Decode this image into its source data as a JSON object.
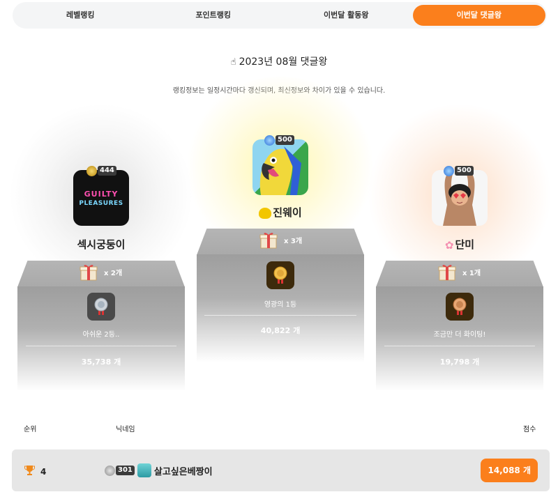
{
  "tabs": [
    {
      "label": "레벨랭킹",
      "active": false
    },
    {
      "label": "포인트랭킹",
      "active": false
    },
    {
      "label": "이번달 활동왕",
      "active": false
    },
    {
      "label": "이번달 댓글왕",
      "active": true
    }
  ],
  "header": {
    "title": "2023년 08월 댓글왕",
    "notice": "랭킹정보는 일정시간마다 갱신되며, 최신정보와 차이가 있을 수 있습니다."
  },
  "podium": {
    "first": {
      "level": "500",
      "nickname": "진웨이",
      "gift_count": "x 3개",
      "medal_label": "영광의 1등",
      "score": "40,822 개",
      "avatar_text": ""
    },
    "second": {
      "level": "444",
      "nickname": "섹시궁둥이",
      "gift_count": "x 2개",
      "medal_label": "아쉬운 2등..",
      "score": "35,738 개",
      "avatar_text_1": "GUILTY",
      "avatar_text_2": "PLEASURES"
    },
    "third": {
      "level": "500",
      "nickname": "단미",
      "gift_count": "x 1개",
      "medal_label": "조금만 더 화이팅!",
      "score": "19,798 개"
    }
  },
  "table": {
    "headers": {
      "rank": "순위",
      "nickname": "닉네임",
      "score": "점수"
    },
    "rows": [
      {
        "rank": "4",
        "level": "301",
        "nickname": "살고싶은베짱이",
        "score": "14,088 개"
      }
    ]
  },
  "colors": {
    "accent": "#fb7f1c",
    "podium_gray": "#a9a9a9"
  }
}
